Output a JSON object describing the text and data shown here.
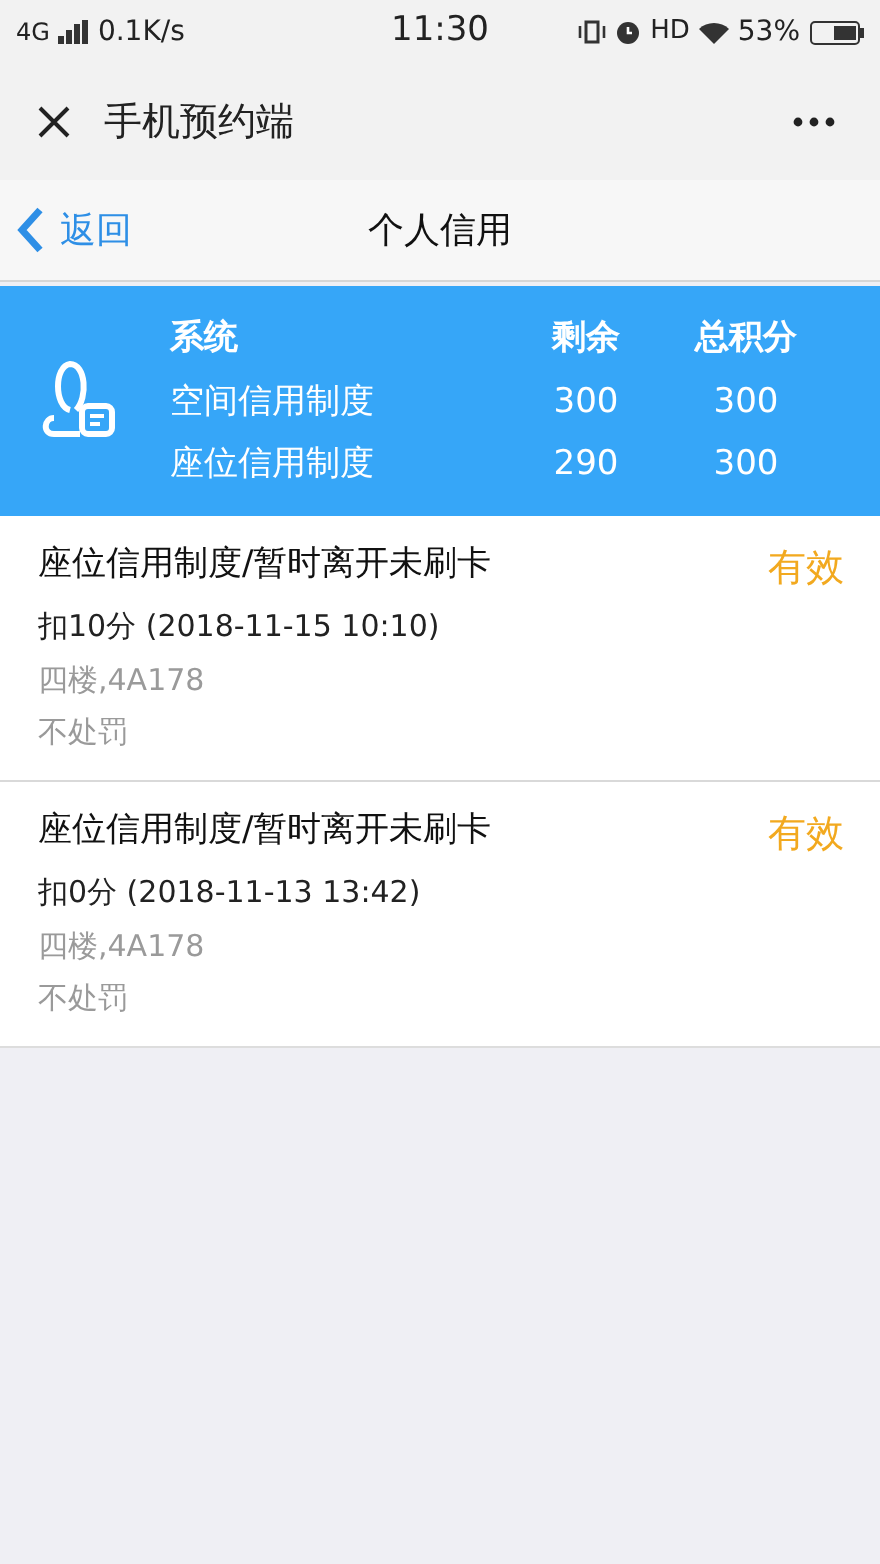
{
  "status_bar": {
    "network": "4G",
    "speed": "0.1K/s",
    "time": "11:30",
    "hd": "HD",
    "battery": "53%"
  },
  "app_bar": {
    "title": "手机预约端"
  },
  "nav_bar": {
    "back": "返回",
    "title": "个人信用"
  },
  "summary": {
    "columns": [
      "系统",
      "剩余",
      "总积分"
    ],
    "rows": [
      {
        "system": "空间信用制度",
        "remaining": "300",
        "total": "300"
      },
      {
        "system": "座位信用制度",
        "remaining": "290",
        "total": "300"
      }
    ]
  },
  "records": [
    {
      "title": "座位信用制度/暂时离开未刷卡",
      "status": "有效",
      "deduction": "扣10分 (2018-11-15 10:10)",
      "location": "四楼,4A178",
      "penalty": "不处罚"
    },
    {
      "title": "座位信用制度/暂时离开未刷卡",
      "status": "有效",
      "deduction": "扣0分 (2018-11-13 13:42)",
      "location": "四楼,4A178",
      "penalty": "不处罚"
    }
  ]
}
